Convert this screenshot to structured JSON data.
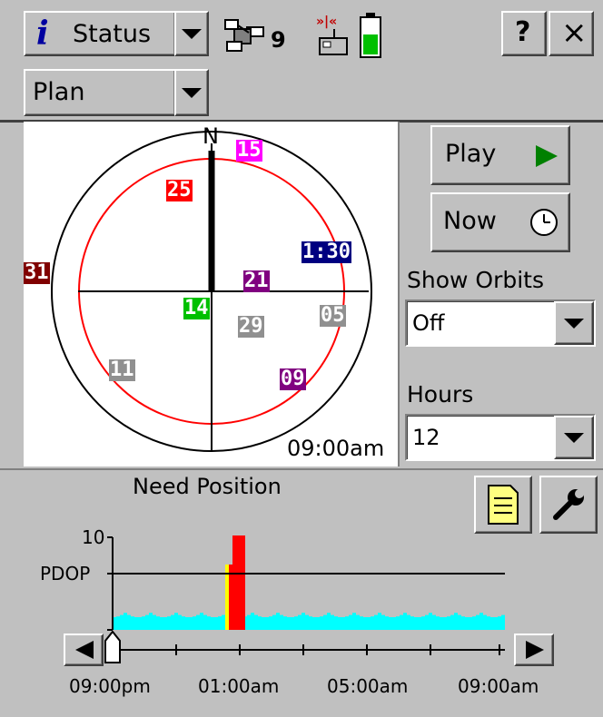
{
  "header": {
    "app_icon": "info-icon",
    "app_label": "Status",
    "satellites_in_use": "9",
    "help_label": "?",
    "close_label": "×"
  },
  "view_selector": {
    "value": "Plan"
  },
  "skyplot": {
    "north_label": "N",
    "time_label": "09:00am",
    "satellites": [
      {
        "id": "15",
        "color": "#ff00ff"
      },
      {
        "id": "25",
        "color": "#ff0000"
      },
      {
        "id": "1:30",
        "color": "#000080"
      },
      {
        "id": "31",
        "color": "#800000"
      },
      {
        "id": "21",
        "color": "#800080"
      },
      {
        "id": "14",
        "color": "#00c000"
      },
      {
        "id": "29",
        "color": "#909090"
      },
      {
        "id": "05",
        "color": "#909090"
      },
      {
        "id": "11",
        "color": "#909090"
      },
      {
        "id": "09",
        "color": "#800080"
      }
    ]
  },
  "controls": {
    "play_label": "Play",
    "now_label": "Now",
    "show_orbits_label": "Show Orbits",
    "show_orbits_value": "Off",
    "hours_label": "Hours",
    "hours_value": "12"
  },
  "status": {
    "message": "Need Position"
  },
  "timeline": {
    "ymax_label": "10",
    "pdop_label": "PDOP",
    "ticks": [
      "09:00pm",
      "01:00am",
      "05:00am",
      "09:00am"
    ]
  },
  "colors": {
    "pdop_fill": "#00ffff",
    "pdop_high": "#ff0000",
    "pdop_warning": "#ffff00",
    "play_arrow": "#008000"
  }
}
